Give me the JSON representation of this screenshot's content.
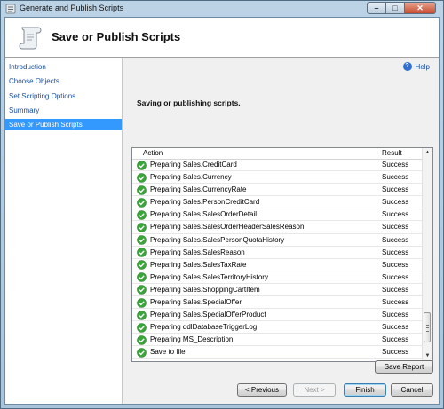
{
  "window": {
    "title": "Generate and Publish Scripts"
  },
  "header": {
    "title": "Save or Publish Scripts"
  },
  "nav": {
    "items": [
      {
        "label": "Introduction",
        "selected": false
      },
      {
        "label": "Choose Objects",
        "selected": false
      },
      {
        "label": "Set Scripting Options",
        "selected": false
      },
      {
        "label": "Summary",
        "selected": false
      },
      {
        "label": "Save or Publish Scripts",
        "selected": true
      }
    ]
  },
  "main": {
    "help_label": "Help",
    "section_title": "Saving or publishing scripts.",
    "grid": {
      "columns": {
        "action": "Action",
        "result": "Result"
      },
      "rows": [
        {
          "action": "Preparing Sales.CreditCard",
          "result": "Success"
        },
        {
          "action": "Preparing Sales.Currency",
          "result": "Success"
        },
        {
          "action": "Preparing Sales.CurrencyRate",
          "result": "Success"
        },
        {
          "action": "Preparing Sales.PersonCreditCard",
          "result": "Success"
        },
        {
          "action": "Preparing Sales.SalesOrderDetail",
          "result": "Success"
        },
        {
          "action": "Preparing Sales.SalesOrderHeaderSalesReason",
          "result": "Success"
        },
        {
          "action": "Preparing Sales.SalesPersonQuotaHistory",
          "result": "Success"
        },
        {
          "action": "Preparing Sales.SalesReason",
          "result": "Success"
        },
        {
          "action": "Preparing Sales.SalesTaxRate",
          "result": "Success"
        },
        {
          "action": "Preparing Sales.SalesTerritoryHistory",
          "result": "Success"
        },
        {
          "action": "Preparing Sales.ShoppingCartItem",
          "result": "Success"
        },
        {
          "action": "Preparing Sales.SpecialOffer",
          "result": "Success"
        },
        {
          "action": "Preparing Sales.SpecialOfferProduct",
          "result": "Success"
        },
        {
          "action": "Preparing ddlDatabaseTriggerLog",
          "result": "Success"
        },
        {
          "action": "Preparing MS_Description",
          "result": "Success"
        },
        {
          "action": "Save to file",
          "result": "Success"
        }
      ]
    },
    "save_report_label": "Save Report"
  },
  "footer": {
    "previous_label": "< Previous",
    "next_label": "Next >",
    "finish_label": "Finish",
    "cancel_label": "Cancel"
  },
  "colors": {
    "selected_nav": "#3399ff",
    "link": "#1a4fa0",
    "success_icon": "#3aa53a"
  }
}
